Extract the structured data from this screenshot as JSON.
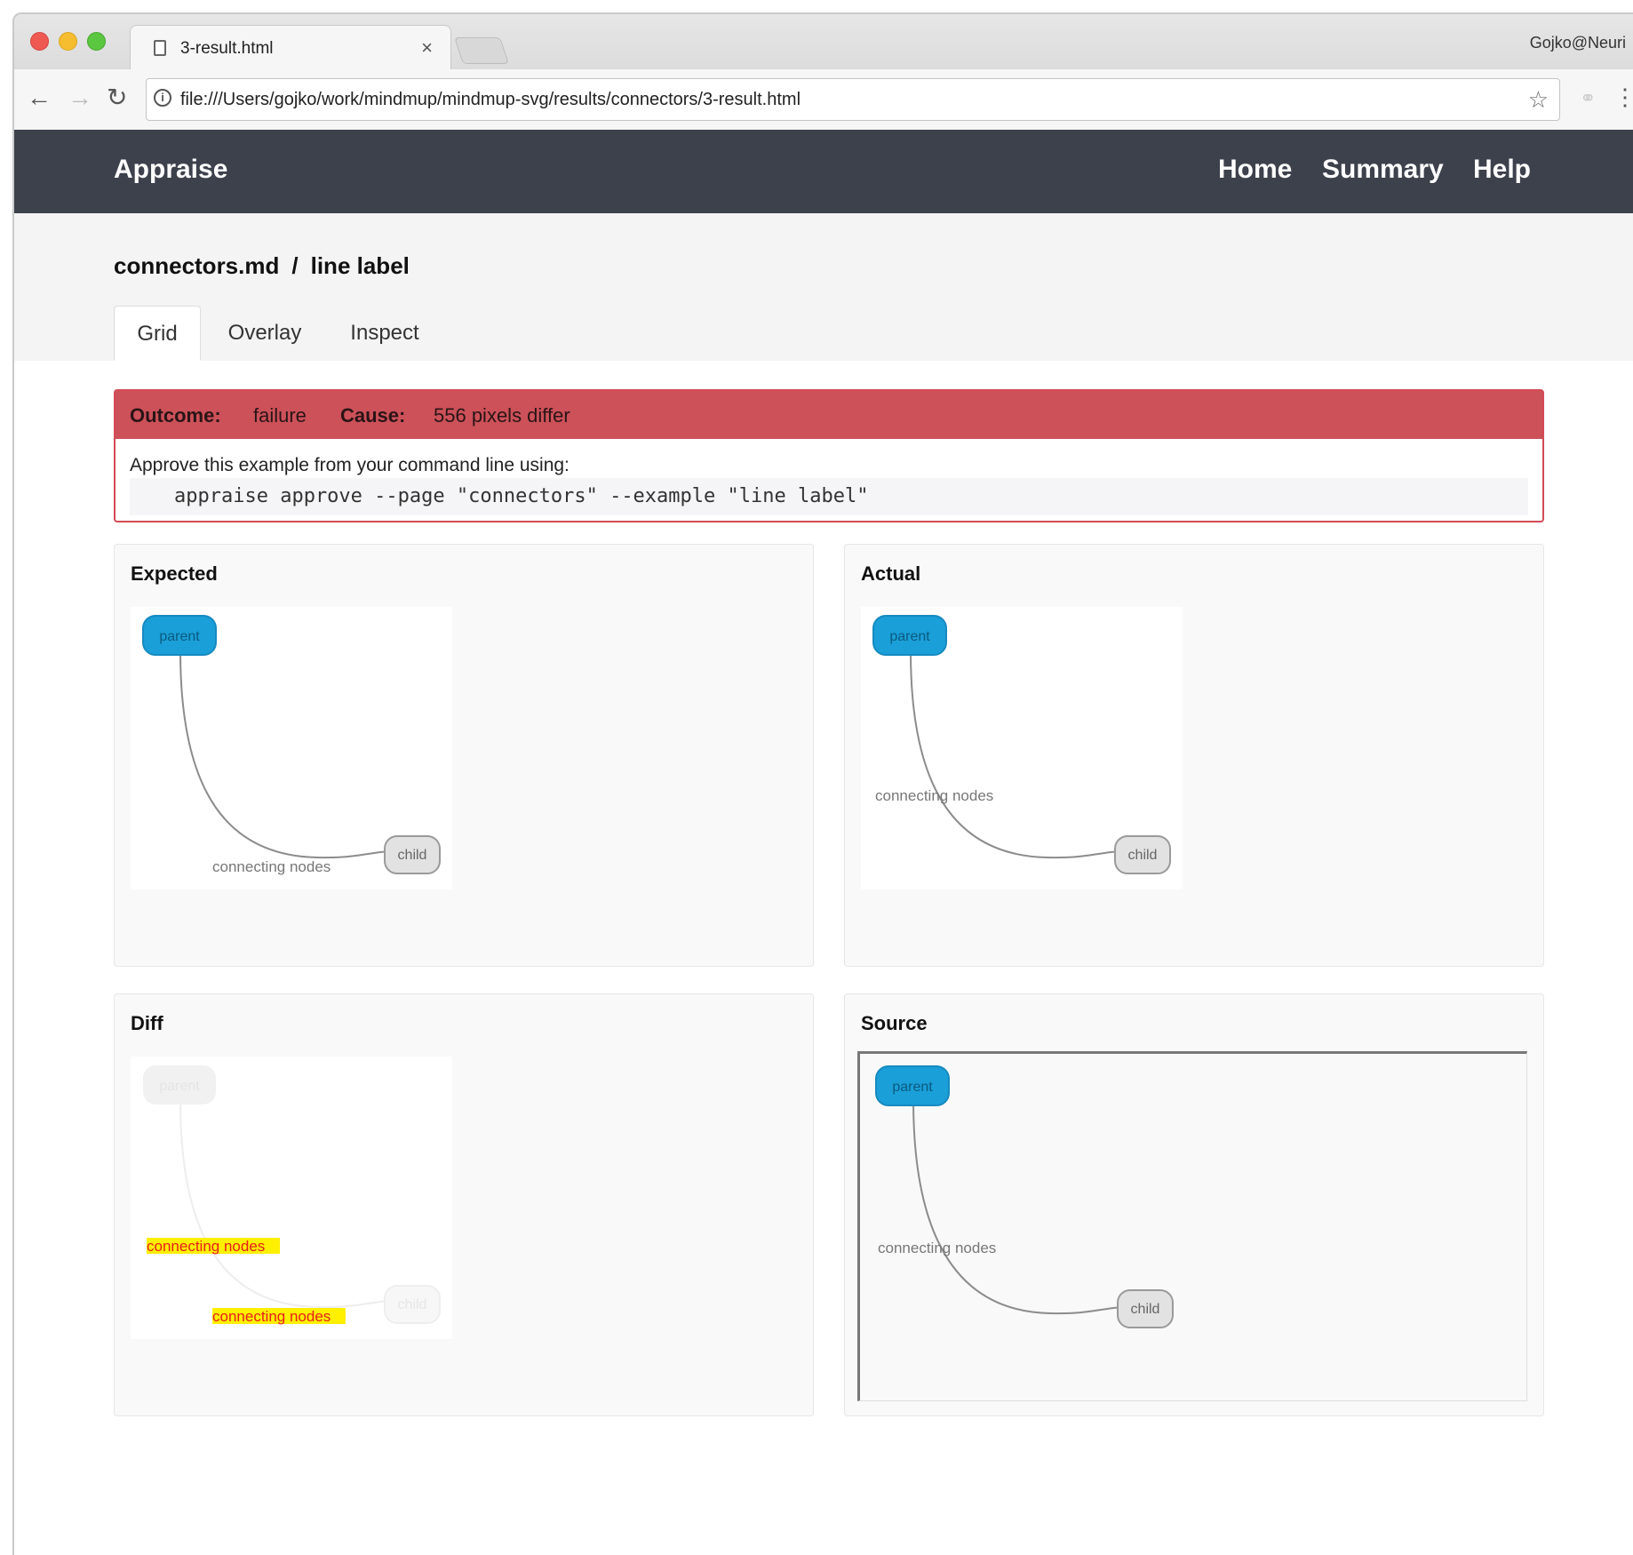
{
  "browser": {
    "tab_title": "3-result.html",
    "tab_close": "×",
    "profile": "Gojko@Neuri",
    "url": "file:///Users/gojko/work/mindmup/mindmup-svg/results/connectors/3-result.html",
    "icons": [
      "back-arrow-icon",
      "forward-arrow-icon",
      "reload-icon",
      "info-icon",
      "star-icon",
      "extension-icon",
      "menu-icon"
    ]
  },
  "appbar": {
    "brand": "Appraise",
    "nav": {
      "home": "Home",
      "summary": "Summary",
      "help": "Help"
    },
    "bg_color": "#3d414c"
  },
  "breadcrumb": {
    "page": "connectors.md",
    "separator": "/",
    "example": "line label"
  },
  "tabs": {
    "grid": "Grid",
    "overlay": "Overlay",
    "inspect": "Inspect",
    "active": "Grid"
  },
  "outcome": {
    "outcome_label": "Outcome:",
    "outcome_value": "failure",
    "cause_label": "Cause:",
    "cause_value": "556 pixels differ",
    "approve_text": "Approve this example from your command line using:",
    "command": "appraise approve --page \"connectors\" --example \"line label\"",
    "color": "#cc5159"
  },
  "panels": {
    "expected": {
      "title": "Expected",
      "parent": "parent",
      "child": "child",
      "label": "connecting nodes"
    },
    "actual": {
      "title": "Actual",
      "parent": "parent",
      "child": "child",
      "label": "connecting nodes"
    },
    "diff": {
      "title": "Diff",
      "parent": "parent",
      "child": "child",
      "label_a": "connecting nodes",
      "label_b": "connecting nodes"
    },
    "source": {
      "title": "Source",
      "parent": "parent",
      "child": "child",
      "label": "connecting nodes"
    }
  },
  "colors": {
    "node_parent": "#1a9fd8",
    "node_child": "#e2e2e2",
    "diff_highlight": "#ffef00",
    "diff_text": "#e8201a"
  }
}
